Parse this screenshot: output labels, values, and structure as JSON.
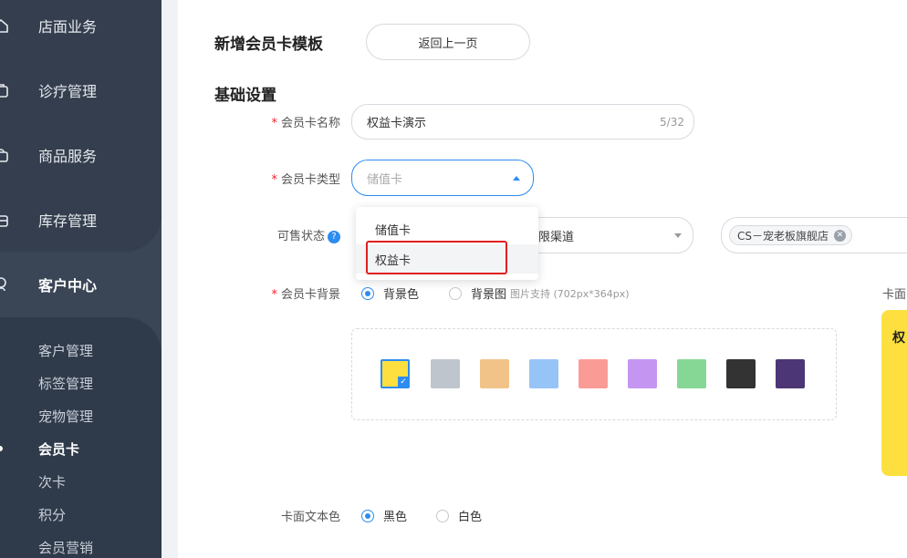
{
  "sidebar": {
    "nav": [
      {
        "label": "店面业务",
        "icon": "home-icon"
      },
      {
        "label": "诊疗管理",
        "icon": "medical-bag-icon"
      },
      {
        "label": "商品服务",
        "icon": "shopping-bag-icon"
      },
      {
        "label": "库存管理",
        "icon": "inventory-icon"
      },
      {
        "label": "客户中心",
        "icon": "customer-icon"
      }
    ],
    "sub": [
      "客户管理",
      "标签管理",
      "宠物管理",
      "会员卡",
      "次卡",
      "积分",
      "会员营销"
    ]
  },
  "header": {
    "title": "新增会员卡模板",
    "back_label": "返回上一页"
  },
  "section_title": "基础设置",
  "form": {
    "name_label": "会员卡名称",
    "name_value": "权益卡演示",
    "name_counter": "5/32",
    "type_label": "会员卡类型",
    "type_placeholder": "储值卡",
    "type_options": [
      "储值卡",
      "权益卡"
    ],
    "sale_label": "可售状态",
    "help_glyph": "?",
    "channel_value": "限渠道",
    "store_tag": "CS－宠老板旗舰店",
    "tag_close_glyph": "✕",
    "bg_label": "会员卡背景",
    "bg_option_color": "背景色",
    "bg_option_image": "背景图",
    "bg_image_hint": "图片支持 (702px*364px)",
    "swatch_colors": [
      "#fde03f",
      "#bfc5cd",
      "#f2c388",
      "#96c4f7",
      "#fb9b96",
      "#c496f2",
      "#86d795",
      "#333333",
      "#4d3675"
    ],
    "check_glyph": "✓",
    "text_color_label": "卡面文本色",
    "text_color_black": "黑色",
    "text_color_white": "白色"
  },
  "preview": {
    "label": "卡面",
    "title_fragment": "权",
    "card_color": "#fde03f"
  },
  "colors": {
    "accent": "#2d8cf0",
    "required": "#f5222d",
    "highlight": "#e02020"
  }
}
